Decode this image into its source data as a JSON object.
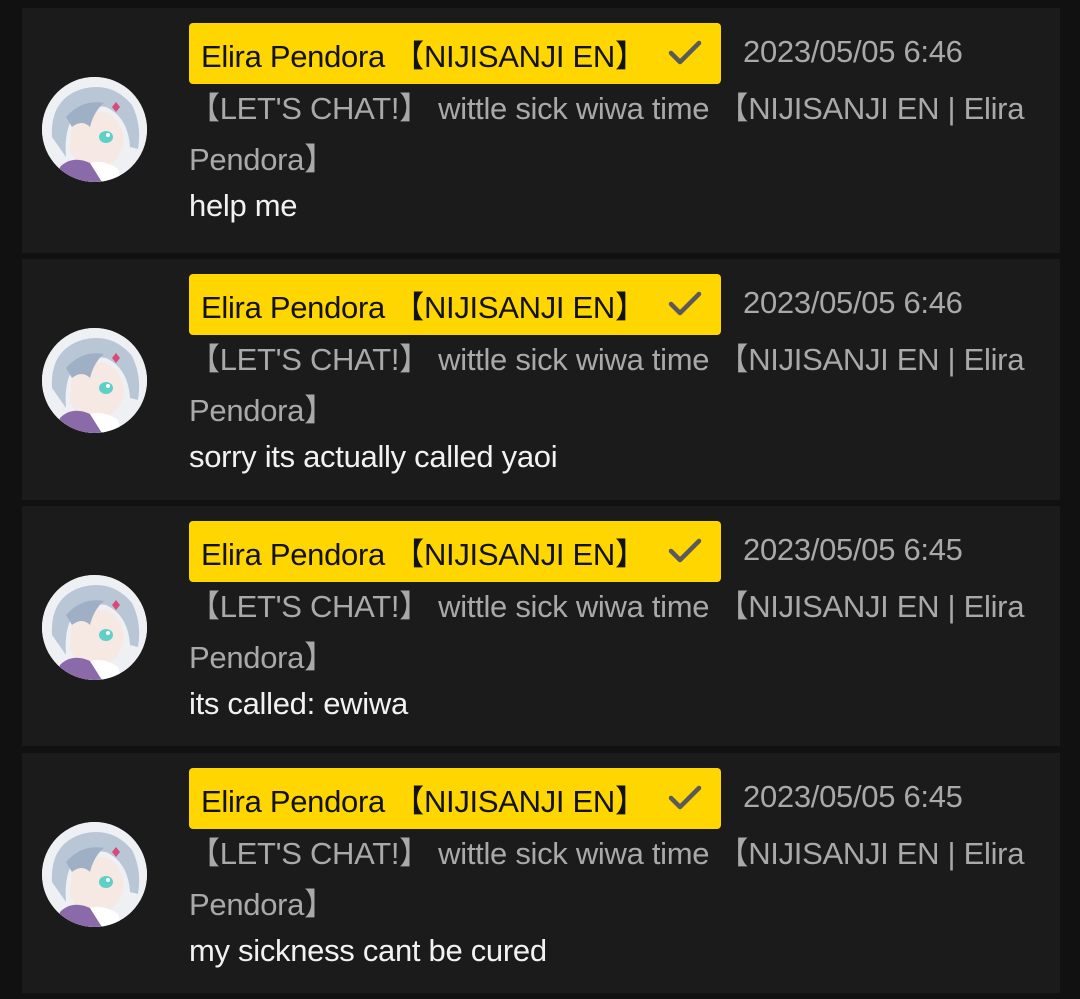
{
  "colors": {
    "background": "#111111",
    "card": "#1b1b1b",
    "badge": "#ffd600",
    "meta_text": "#a9a9a9",
    "message_text": "#f2f2f2"
  },
  "messages": [
    {
      "author": "Elira Pendora 【NIJISANJI EN】",
      "verified_icon": "check-icon",
      "timestamp": "2023/05/05 6:46",
      "video_title": "【LET'S CHAT!】 wittle sick wiwa time 【NIJISANJI EN | Elira Pendora】",
      "text": "help me"
    },
    {
      "author": "Elira Pendora 【NIJISANJI EN】",
      "verified_icon": "check-icon",
      "timestamp": "2023/05/05 6:46",
      "video_title": "【LET'S CHAT!】 wittle sick wiwa time 【NIJISANJI EN | Elira Pendora】",
      "text": "sorry its actually called yaoi"
    },
    {
      "author": "Elira Pendora 【NIJISANJI EN】",
      "verified_icon": "check-icon",
      "timestamp": "2023/05/05 6:45",
      "video_title": "【LET'S CHAT!】 wittle sick wiwa time 【NIJISANJI EN | Elira Pendora】",
      "text": "its called: ewiwa"
    },
    {
      "author": "Elira Pendora 【NIJISANJI EN】",
      "verified_icon": "check-icon",
      "timestamp": "2023/05/05 6:45",
      "video_title": "【LET'S CHAT!】 wittle sick wiwa time 【NIJISANJI EN | Elira Pendora】",
      "text": "my sickness cant be cured"
    }
  ]
}
